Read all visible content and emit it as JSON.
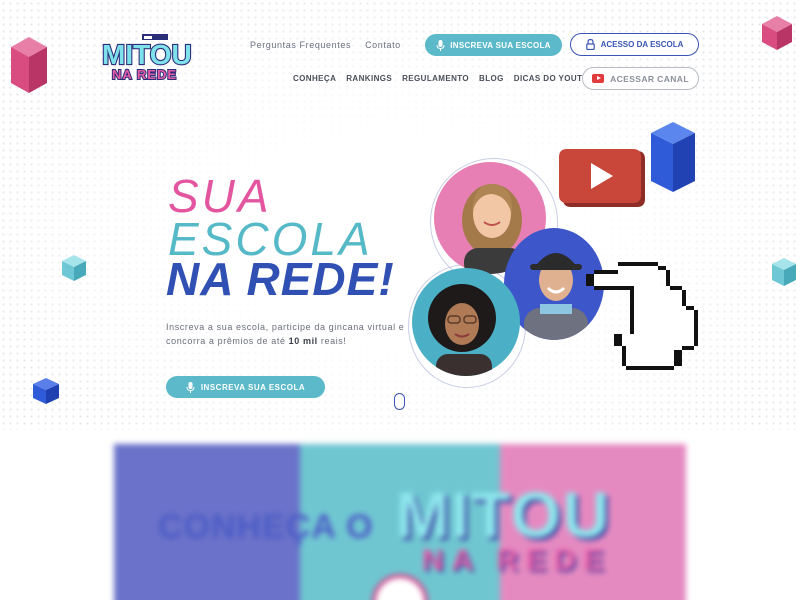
{
  "brand": {
    "logo_line1": "MITOU",
    "logo_line2": "NA REDE"
  },
  "top_links": [
    {
      "label": "Perguntas Frequentes"
    },
    {
      "label": "Contato"
    }
  ],
  "header_buttons": {
    "subscribe": "INSCREVA SUA ESCOLA",
    "school_access": "ACESSO DA ESCOLA",
    "channel": "ACESSAR CANAL"
  },
  "main_nav": [
    {
      "label": "CONHEÇA"
    },
    {
      "label": "RANKINGS"
    },
    {
      "label": "REGULAMENTO"
    },
    {
      "label": "BLOG"
    },
    {
      "label": "DICAS DO YOUTUBER"
    }
  ],
  "hero": {
    "line1": "SUA",
    "line2": "ESCOLA",
    "line3": "NA REDE!",
    "desc_prefix": "Inscreva a sua escola, participe da gincana virtual e concorra a prêmios de até ",
    "desc_highlight": "10 mil",
    "desc_suffix": " reais!",
    "cta": "INSCREVA SUA ESCOLA"
  },
  "video": {
    "text_left": "CONHEÇA O",
    "text_title": "MITOU",
    "text_sub": "NA REDE"
  },
  "colors": {
    "pink": "#e4559f",
    "teal": "#56b9c7",
    "blue": "#3050b3",
    "button_teal": "#5bb9c9",
    "youtube_red": "#c9473a"
  },
  "icons": {
    "subscribe": "microphone-icon",
    "lock": "lock-icon",
    "youtube": "youtube-icon",
    "cursor": "pixel-hand-cursor-icon",
    "play": "play-icon"
  }
}
